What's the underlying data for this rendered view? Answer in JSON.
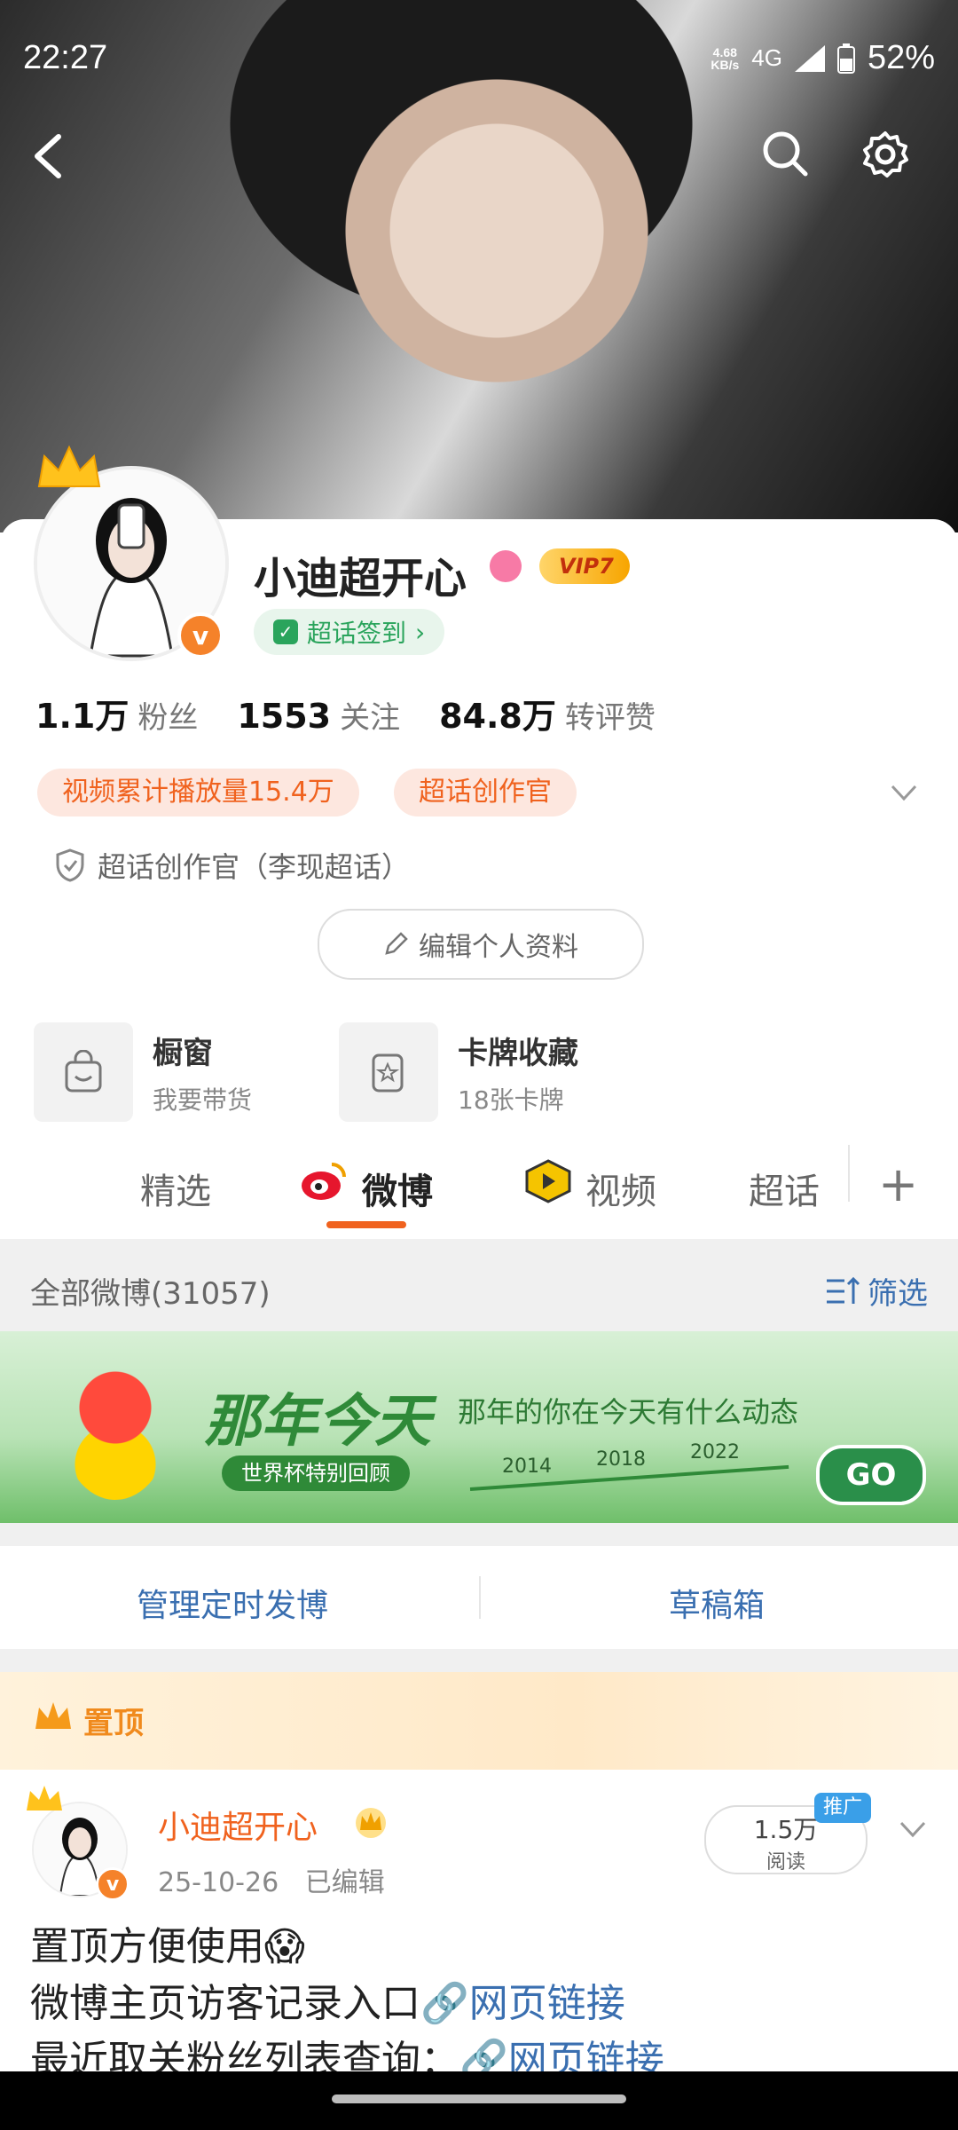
{
  "status_bar": {
    "time": "22:27",
    "net_speed_top": "4.68",
    "net_speed_bottom": "KB/s",
    "network": "4G",
    "battery": "52%"
  },
  "profile": {
    "name": "小迪超开心",
    "vip": "VIP7",
    "checkin": "超话签到",
    "stats": [
      {
        "num": "1.1万",
        "label": "粉丝"
      },
      {
        "num": "1553",
        "label": "关注"
      },
      {
        "num": "84.8万",
        "label": "转评赞"
      }
    ],
    "tags": [
      "视频累计播放量15.4万",
      "超话创作官"
    ],
    "honor": "超话创作官（李现超话）",
    "edit_button": "编辑个人资料"
  },
  "tools": [
    {
      "title": "橱窗",
      "sub": "我要带货"
    },
    {
      "title": "卡牌收藏",
      "sub": "18张卡牌"
    }
  ],
  "tabs": [
    "精选",
    "微博",
    "视频",
    "超话"
  ],
  "feed": {
    "all_label": "全部微博(31057)",
    "filter_label": "筛选",
    "promo": {
      "title": "那年今天",
      "subtitle": "那年的你在今天有什么动态",
      "pill": "世界杯特别回顾",
      "years": [
        "2014",
        "2018",
        "2022"
      ],
      "go": "GO"
    },
    "actions": [
      "管理定时发博",
      "草稿箱"
    ],
    "pinned_label": "置顶",
    "post": {
      "author": "小迪超开心",
      "date": "25-10-26",
      "edited": "已编辑",
      "reads_num": "1.5万",
      "reads_label": "阅读",
      "promo_tag": "推广",
      "line1": "置顶方便使用😱",
      "line2_text": "微博主页访客记录入口",
      "line2_link": "网页链接",
      "line3_text": "最近取关粉丝列表查询：",
      "line3_link": "网页链接"
    }
  }
}
